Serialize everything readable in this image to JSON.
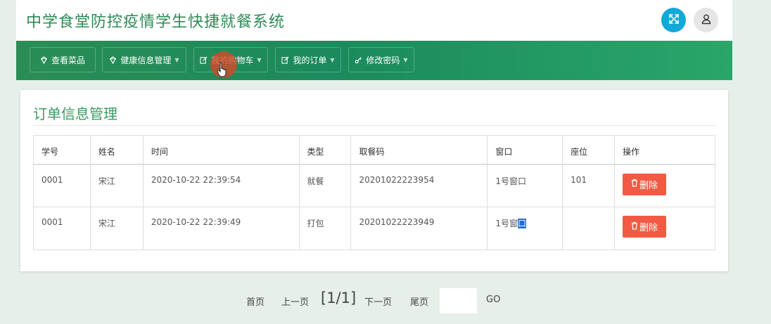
{
  "app": {
    "title": "中学食堂防控疫情学生快捷就餐系统"
  },
  "colors": {
    "brand": "#2e8b57",
    "fullscreen_button": "#12a8d8",
    "delete_button": "#f25a44"
  },
  "header": {
    "fullscreen_icon": "expand-arrows-icon",
    "user_icon": "user-icon"
  },
  "nav": {
    "items": [
      {
        "label": "查看菜品",
        "icon": "gem-icon",
        "has_caret": false
      },
      {
        "label": "健康信息管理",
        "icon": "gem-icon",
        "has_caret": true
      },
      {
        "label": "我的购物车",
        "icon": "edit-icon",
        "has_caret": true
      },
      {
        "label": "我的订单",
        "icon": "edit-icon",
        "has_caret": true
      },
      {
        "label": "修改密码",
        "icon": "key-icon",
        "has_caret": true
      }
    ]
  },
  "panel": {
    "title": "订单信息管理"
  },
  "table": {
    "headers": [
      "学号",
      "姓名",
      "时间",
      "类型",
      "取餐码",
      "窗口",
      "座位",
      "操作"
    ],
    "rows": [
      {
        "student_id": "0001",
        "name": "宋江",
        "time": "2020-10-22 22:39:54",
        "type": "就餐",
        "pickup_code": "20201022223954",
        "window": "1号窗口",
        "seat": "101",
        "action": "删除"
      },
      {
        "student_id": "0001",
        "name": "宋江",
        "time": "2020-10-22 22:39:49",
        "type": "打包",
        "pickup_code": "20201022223949",
        "window": "1号窗口",
        "seat": "",
        "action": "删除"
      }
    ]
  },
  "pager": {
    "first": "首页",
    "prev": "上一页",
    "current": "[1/1]",
    "next": "下一页",
    "last": "尾页",
    "input_value": "",
    "go": "GO"
  }
}
